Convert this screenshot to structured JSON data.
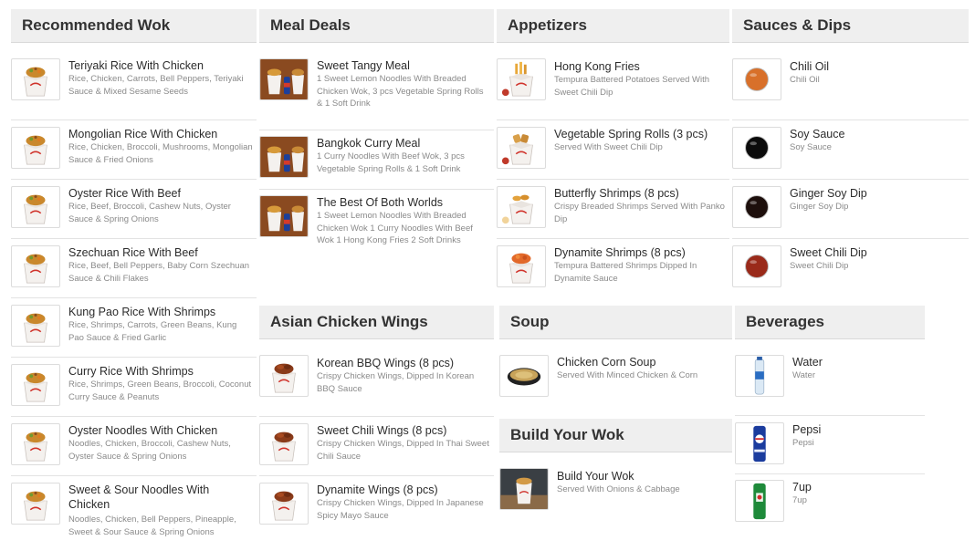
{
  "sections": {
    "recommended": {
      "title": "Recommended Wok",
      "items": [
        {
          "name": "Teriyaki Rice With Chicken",
          "desc": "Rice, Chicken, Carrots, Bell Peppers, Teriyaki Sauce & Mixed Sesame Seeds",
          "icon": "wok-box-icon"
        },
        {
          "name": "Mongolian Rice With Chicken",
          "desc": "Rice, Chicken, Broccoli, Mushrooms, Mongolian Sauce & Fried Onions",
          "icon": "wok-box-icon"
        },
        {
          "name": "Oyster Rice With Beef",
          "desc": "Rice, Beef, Broccoli, Cashew Nuts, Oyster Sauce & Spring Onions",
          "icon": "wok-box-icon"
        },
        {
          "name": "Szechuan Rice With Beef",
          "desc": "Rice, Beef, Bell Peppers, Baby Corn Szechuan Sauce & Chili Flakes",
          "icon": "wok-box-icon"
        },
        {
          "name": "Kung Pao Rice With Shrimps",
          "desc": "Rice, Shrimps, Carrots, Green Beans, Kung Pao Sauce & Fried Garlic",
          "icon": "wok-box-icon"
        },
        {
          "name": "Curry Rice With Shrimps",
          "desc": "Rice, Shrimps, Green Beans, Broccoli, Coconut Curry Sauce & Peanuts",
          "icon": "wok-box-icon"
        },
        {
          "name": "Oyster Noodles With Chicken",
          "desc": "Noodles, Chicken, Broccoli, Cashew Nuts, Oyster Sauce & Spring Onions",
          "icon": "wok-box-icon"
        },
        {
          "name": "Sweet & Sour Noodles With Chicken",
          "desc": "Noodles, Chicken, Bell Peppers, Pineapple, Sweet & Sour Sauce & Spring Onions",
          "icon": "wok-box-icon"
        }
      ]
    },
    "meal_deals": {
      "title": "Meal Deals",
      "items": [
        {
          "name": "Sweet Tangy Meal",
          "desc": "1 Sweet Lemon Noodles With Breaded Chicken Wok, 3 pcs Vegetable Spring Rolls & 1 Soft Drink",
          "icon": "meal-combo-icon"
        },
        {
          "name": "Bangkok Curry Meal",
          "desc": "1 Curry Noodles With Beef Wok, 3 pcs Vegetable Spring Rolls & 1 Soft Drink",
          "icon": "meal-combo-icon"
        },
        {
          "name": "The Best Of Both Worlds",
          "desc": "1 Sweet Lemon Noodles With Breaded Chicken Wok 1 Curry Noodles With Beef Wok 1 Hong Kong Fries 2 Soft Drinks",
          "icon": "meal-combo-icon"
        }
      ]
    },
    "appetizers": {
      "title": "Appetizers",
      "items": [
        {
          "name": "Hong Kong Fries",
          "desc": "Tempura Battered Potatoes Served With Sweet Chili Dip",
          "icon": "fries-box-icon"
        },
        {
          "name": "Vegetable Spring Rolls (3 pcs)",
          "desc": "Served With Sweet Chili Dip",
          "icon": "spring-rolls-box-icon"
        },
        {
          "name": "Butterfly Shrimps (8 pcs)",
          "desc": "Crispy Breaded Shrimps Served With Panko Dip",
          "icon": "shrimp-box-icon"
        },
        {
          "name": "Dynamite Shrimps (8 pcs)",
          "desc": "Tempura Battered Shrimps Dipped In Dynamite Sauce",
          "icon": "dynamite-shrimp-box-icon"
        }
      ]
    },
    "sauces": {
      "title": "Sauces & Dips",
      "items": [
        {
          "name": "Chili Oil",
          "desc": "Chili Oil",
          "icon": "chili-oil-cup-icon",
          "color": "#d8702a"
        },
        {
          "name": "Soy Sauce",
          "desc": "Soy Sauce",
          "icon": "soy-sauce-cup-icon",
          "color": "#0b0b0b"
        },
        {
          "name": "Ginger Soy Dip",
          "desc": "Ginger Soy Dip",
          "icon": "ginger-soy-cup-icon",
          "color": "#1d0f0c"
        },
        {
          "name": "Sweet Chili Dip",
          "desc": "Sweet Chili Dip",
          "icon": "sweet-chili-cup-icon",
          "color": "#9a2a1a"
        }
      ]
    },
    "wings": {
      "title": "Asian Chicken Wings",
      "items": [
        {
          "name": "Korean BBQ Wings (8 pcs)",
          "desc": "Crispy Chicken Wings, Dipped In Korean BBQ Sauce",
          "icon": "wings-box-icon"
        },
        {
          "name": "Sweet Chili Wings (8 pcs)",
          "desc": "Crispy Chicken Wings, Dipped In Thai Sweet Chili Sauce",
          "icon": "wings-box-icon"
        },
        {
          "name": "Dynamite Wings (8 pcs)",
          "desc": "Crispy Chicken Wings, Dipped In Japanese Spicy Mayo Sauce",
          "icon": "wings-box-icon"
        }
      ]
    },
    "soup": {
      "title": "Soup",
      "items": [
        {
          "name": "Chicken Corn Soup",
          "desc": "Served With Minced Chicken & Corn",
          "icon": "soup-bowl-icon"
        }
      ]
    },
    "build": {
      "title": "Build Your Wok",
      "items": [
        {
          "name": "Build Your Wok",
          "desc": "Served With Onions & Cabbage",
          "icon": "build-wok-photo-icon"
        }
      ]
    },
    "beverages": {
      "title": "Beverages",
      "items": [
        {
          "name": "Water",
          "desc": "Water",
          "icon": "water-bottle-icon"
        },
        {
          "name": "Pepsi",
          "desc": "Pepsi",
          "icon": "pepsi-can-icon"
        },
        {
          "name": "7up",
          "desc": "7up",
          "icon": "7up-can-icon"
        }
      ]
    }
  }
}
